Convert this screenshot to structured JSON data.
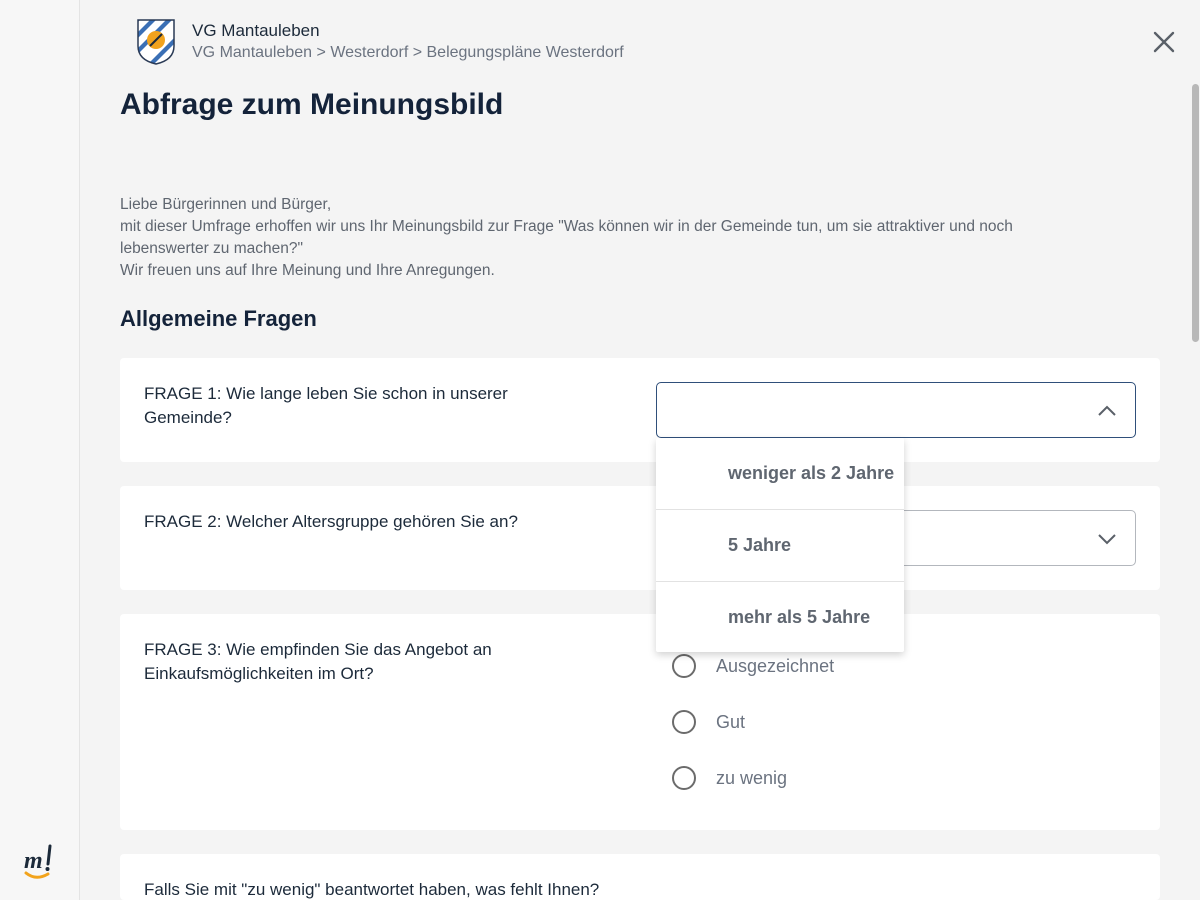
{
  "header": {
    "org_name": "VG Mantauleben",
    "breadcrumb": "VG Mantauleben > Westerdorf > Belegungspläne Westerdorf"
  },
  "page": {
    "title": "Abfrage zum Meinungsbild",
    "intro_lines": [
      "Liebe Bürgerinnen und Bürger,",
      "mit dieser Umfrage erhoffen wir uns Ihr Meinungsbild zur Frage \"Was können wir in der Gemeinde tun, um sie attraktiver und noch lebenswerter zu machen?\"",
      "Wir freuen uns auf Ihre Meinung und Ihre Anregungen."
    ],
    "section_title": "Allgemeine Fragen"
  },
  "questions": [
    {
      "label": "FRAGE 1: Wie lange leben Sie schon in unserer Gemeinde?",
      "type": "select",
      "value": "",
      "open": true,
      "options": [
        "weniger als 2 Jahre",
        "5 Jahre",
        "mehr als 5 Jahre"
      ]
    },
    {
      "label": "FRAGE 2: Welcher Altersgruppe gehören Sie an?",
      "type": "select",
      "value": ""
    },
    {
      "label": "FRAGE 3: Wie empfinden Sie das Angebot an Einkaufsmöglichkeiten im Ort?",
      "type": "radio",
      "options": [
        "Ausgezeichnet",
        "Gut",
        "zu wenig"
      ]
    },
    {
      "label": "Falls Sie mit \"zu wenig\" beantwortet haben, was fehlt Ihnen?"
    }
  ],
  "icons": {
    "close": "close-icon",
    "chevron_up": "chevron-up-icon",
    "chevron_down": "chevron-down-icon",
    "crest": "coat-of-arms-icon",
    "brand": "brand-logo-icon"
  },
  "colors": {
    "accent": "#2f4f7a",
    "title": "#14233a",
    "muted": "#6b7380",
    "crest_blue": "#3a6fb5",
    "crest_gold": "#f0a21e",
    "brand_orange": "#f2a31b"
  }
}
